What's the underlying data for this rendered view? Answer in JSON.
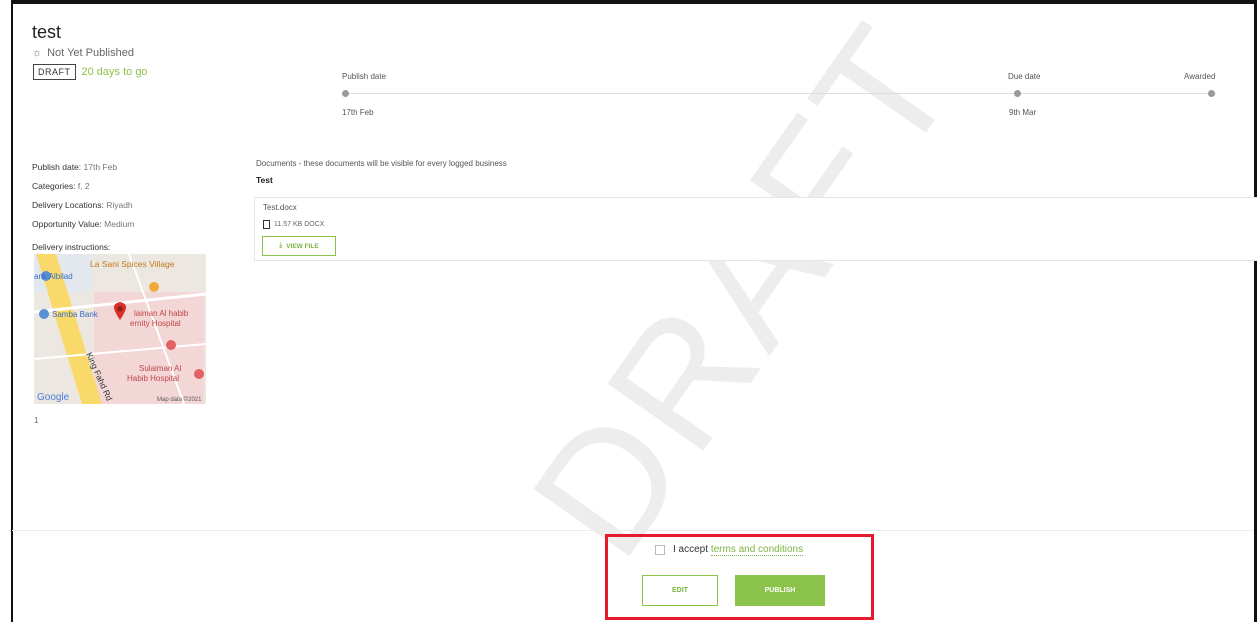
{
  "header": {
    "title": "test",
    "status": "Not Yet Published",
    "badge": "DRAFT",
    "days_left": "20 days to go"
  },
  "timeline": {
    "steps": [
      {
        "label": "Publish date",
        "date": "17th Feb"
      },
      {
        "label": "Due date",
        "date": "9th Mar"
      },
      {
        "label": "Awarded",
        "date": ""
      }
    ]
  },
  "details": {
    "publish_date_label": "Publish date:",
    "publish_date_value": "17th Feb",
    "categories_label": "Categories:",
    "categories_value": "f, 2",
    "delivery_locations_label": "Delivery Locations:",
    "delivery_locations_value": "Riyadh",
    "opportunity_value_label": "Opportunity Value:",
    "opportunity_value_value": "Medium",
    "delivery_instructions_label": "Delivery instructions:",
    "delivery_instructions_value": "1"
  },
  "map": {
    "labels": [
      "La Sani Spices Village",
      "ank Albilad",
      "Samba Bank",
      "laiman Al habib",
      "ernity Hospital",
      "Sulaiman Al",
      "Habib Hospital",
      "King Fahd Rd",
      "Google",
      "Map data ©2021"
    ]
  },
  "documents": {
    "heading": "Documents - these documents will be visible for every logged business",
    "group": "Test",
    "file_name": "Test.docx",
    "file_meta": "11.57 KB DOCX",
    "view_label": "VIEW FILE"
  },
  "watermark": "DRAFT",
  "footer": {
    "accept_text": "I accept",
    "terms_link": "terms and conditions",
    "edit_label": "EDIT",
    "publish_label": "PUBLISH"
  },
  "colors": {
    "accent": "#8bc34a",
    "highlight_box": "#e51a2c"
  }
}
